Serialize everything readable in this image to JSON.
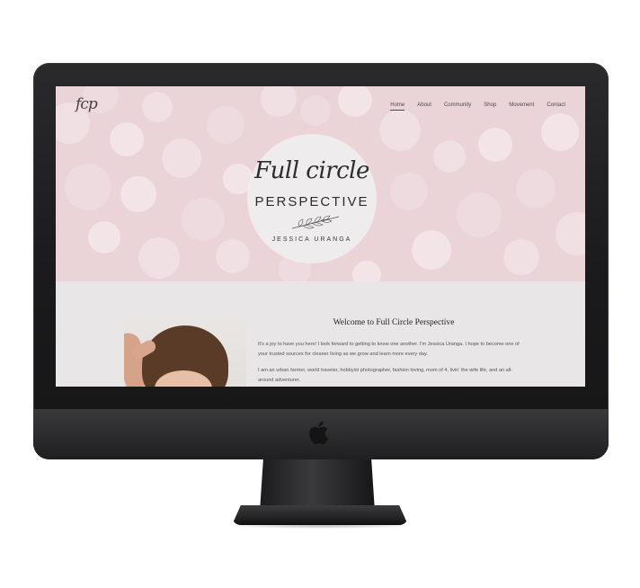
{
  "site": {
    "logo_text": "fcp",
    "nav": {
      "home": "Home",
      "about": "About",
      "community": "Community",
      "shop": "Shop",
      "movement": "Movement",
      "contact": "Contact"
    },
    "emblem": {
      "script_title": "Full circle",
      "title": "PERSPECTIVE",
      "author": "JESSICA URANGA"
    },
    "welcome": {
      "heading": "Welcome to Full Circle Perspective",
      "paragraph_1": "It's a joy to have you here! I look forward to getting to know one another. I'm Jessica Uranga. I hope to become one of your trusted sources for cleaner living as we grow and learn more every day.",
      "paragraph_2": "I am an urban farmer, world traveler, hobbyist photographer, fashion loving, mom of 4, livin' the wife life, and an all-around adventurer."
    }
  },
  "colors": {
    "hero_pink": "#ead4d8",
    "content_gray": "#e8e6e6",
    "monitor_black": "#1a1a1c"
  },
  "icons": {
    "device_logo": "apple-icon",
    "emblem_decoration": "leaf-sprig-icon"
  }
}
